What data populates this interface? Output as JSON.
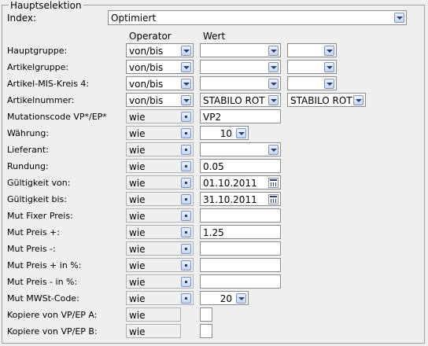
{
  "legend": "Hauptselektion",
  "index": {
    "label": "Index:",
    "value": "Optimiert"
  },
  "headers": {
    "operator": "Operator",
    "wert": "Wert"
  },
  "rows": [
    {
      "label": "Hauptgruppe:",
      "operator": "von/bis",
      "value1": "",
      "value2": ""
    },
    {
      "label": "Artikelgruppe:",
      "operator": "von/bis",
      "value1": "",
      "value2": ""
    },
    {
      "label": "Artikel-MIS-Kreis 4:",
      "operator": "von/bis",
      "value1": "",
      "value2": ""
    },
    {
      "label": "Artikelnummer:",
      "operator": "von/bis",
      "value1": "STABILO ROT",
      "value2": "STABILO ROT"
    },
    {
      "label": "Mutationscode VP*/EP*",
      "operator": "wie",
      "value": "VP2"
    },
    {
      "label": "Währung:",
      "operator": "wie",
      "value": "10"
    },
    {
      "label": "Lieferant:",
      "operator": "wie",
      "value": ""
    },
    {
      "label": "Rundung:",
      "operator": "wie",
      "value": "0.05"
    },
    {
      "label": "Gültigkeit von:",
      "operator": "wie",
      "value": "01.10.2011"
    },
    {
      "label": "Gültigkeit bis:",
      "operator": "wie",
      "value": "31.10.2011"
    },
    {
      "label": "Mut Fixer Preis:",
      "operator": "wie",
      "value": ""
    },
    {
      "label": "Mut Preis +:",
      "operator": "wie",
      "value": "1.25"
    },
    {
      "label": "Mut Preis -:",
      "operator": "wie",
      "value": ""
    },
    {
      "label": "Mut Preis + in %:",
      "operator": "wie",
      "value": ""
    },
    {
      "label": "Mut Preis - in %:",
      "operator": "wie",
      "value": ""
    },
    {
      "label": "Mut MWSt-Code:",
      "operator": "wie",
      "value": "20"
    },
    {
      "label": "Kopiere von VP/EP A:",
      "operator": "wie",
      "checked": false
    },
    {
      "label": "Kopiere von VP/EP B:",
      "operator": "wie",
      "checked": false
    }
  ]
}
